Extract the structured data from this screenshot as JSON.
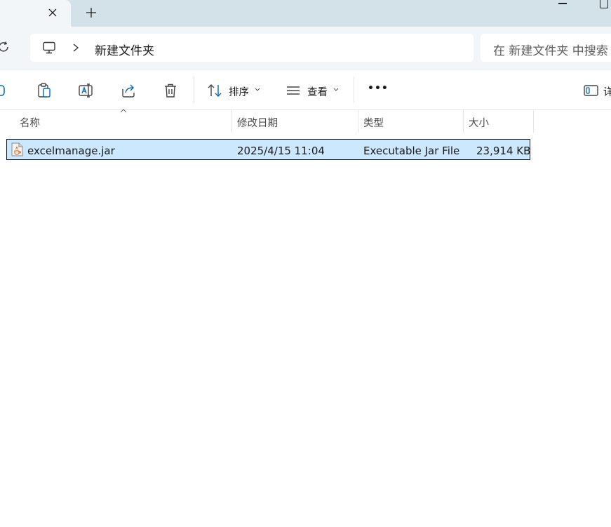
{
  "tabs": {
    "close_symbol": "✕",
    "new_symbol": "+"
  },
  "address": {
    "breadcrumb": "新建文件夹",
    "search_placeholder": "在 新建文件夹 中搜索"
  },
  "toolbar": {
    "sort_label": "排序",
    "view_label": "查看",
    "more_label": "•••",
    "details_label": "详"
  },
  "columns": {
    "name": "名称",
    "modified": "修改日期",
    "type": "类型",
    "size": "大小"
  },
  "files": [
    {
      "name": "excelmanage.jar",
      "modified": "2025/4/15 11:04",
      "type": "Executable Jar File",
      "size": "23,914 KB"
    }
  ],
  "colors": {
    "selection": "#cce8ff",
    "accent": "#0067c0"
  }
}
